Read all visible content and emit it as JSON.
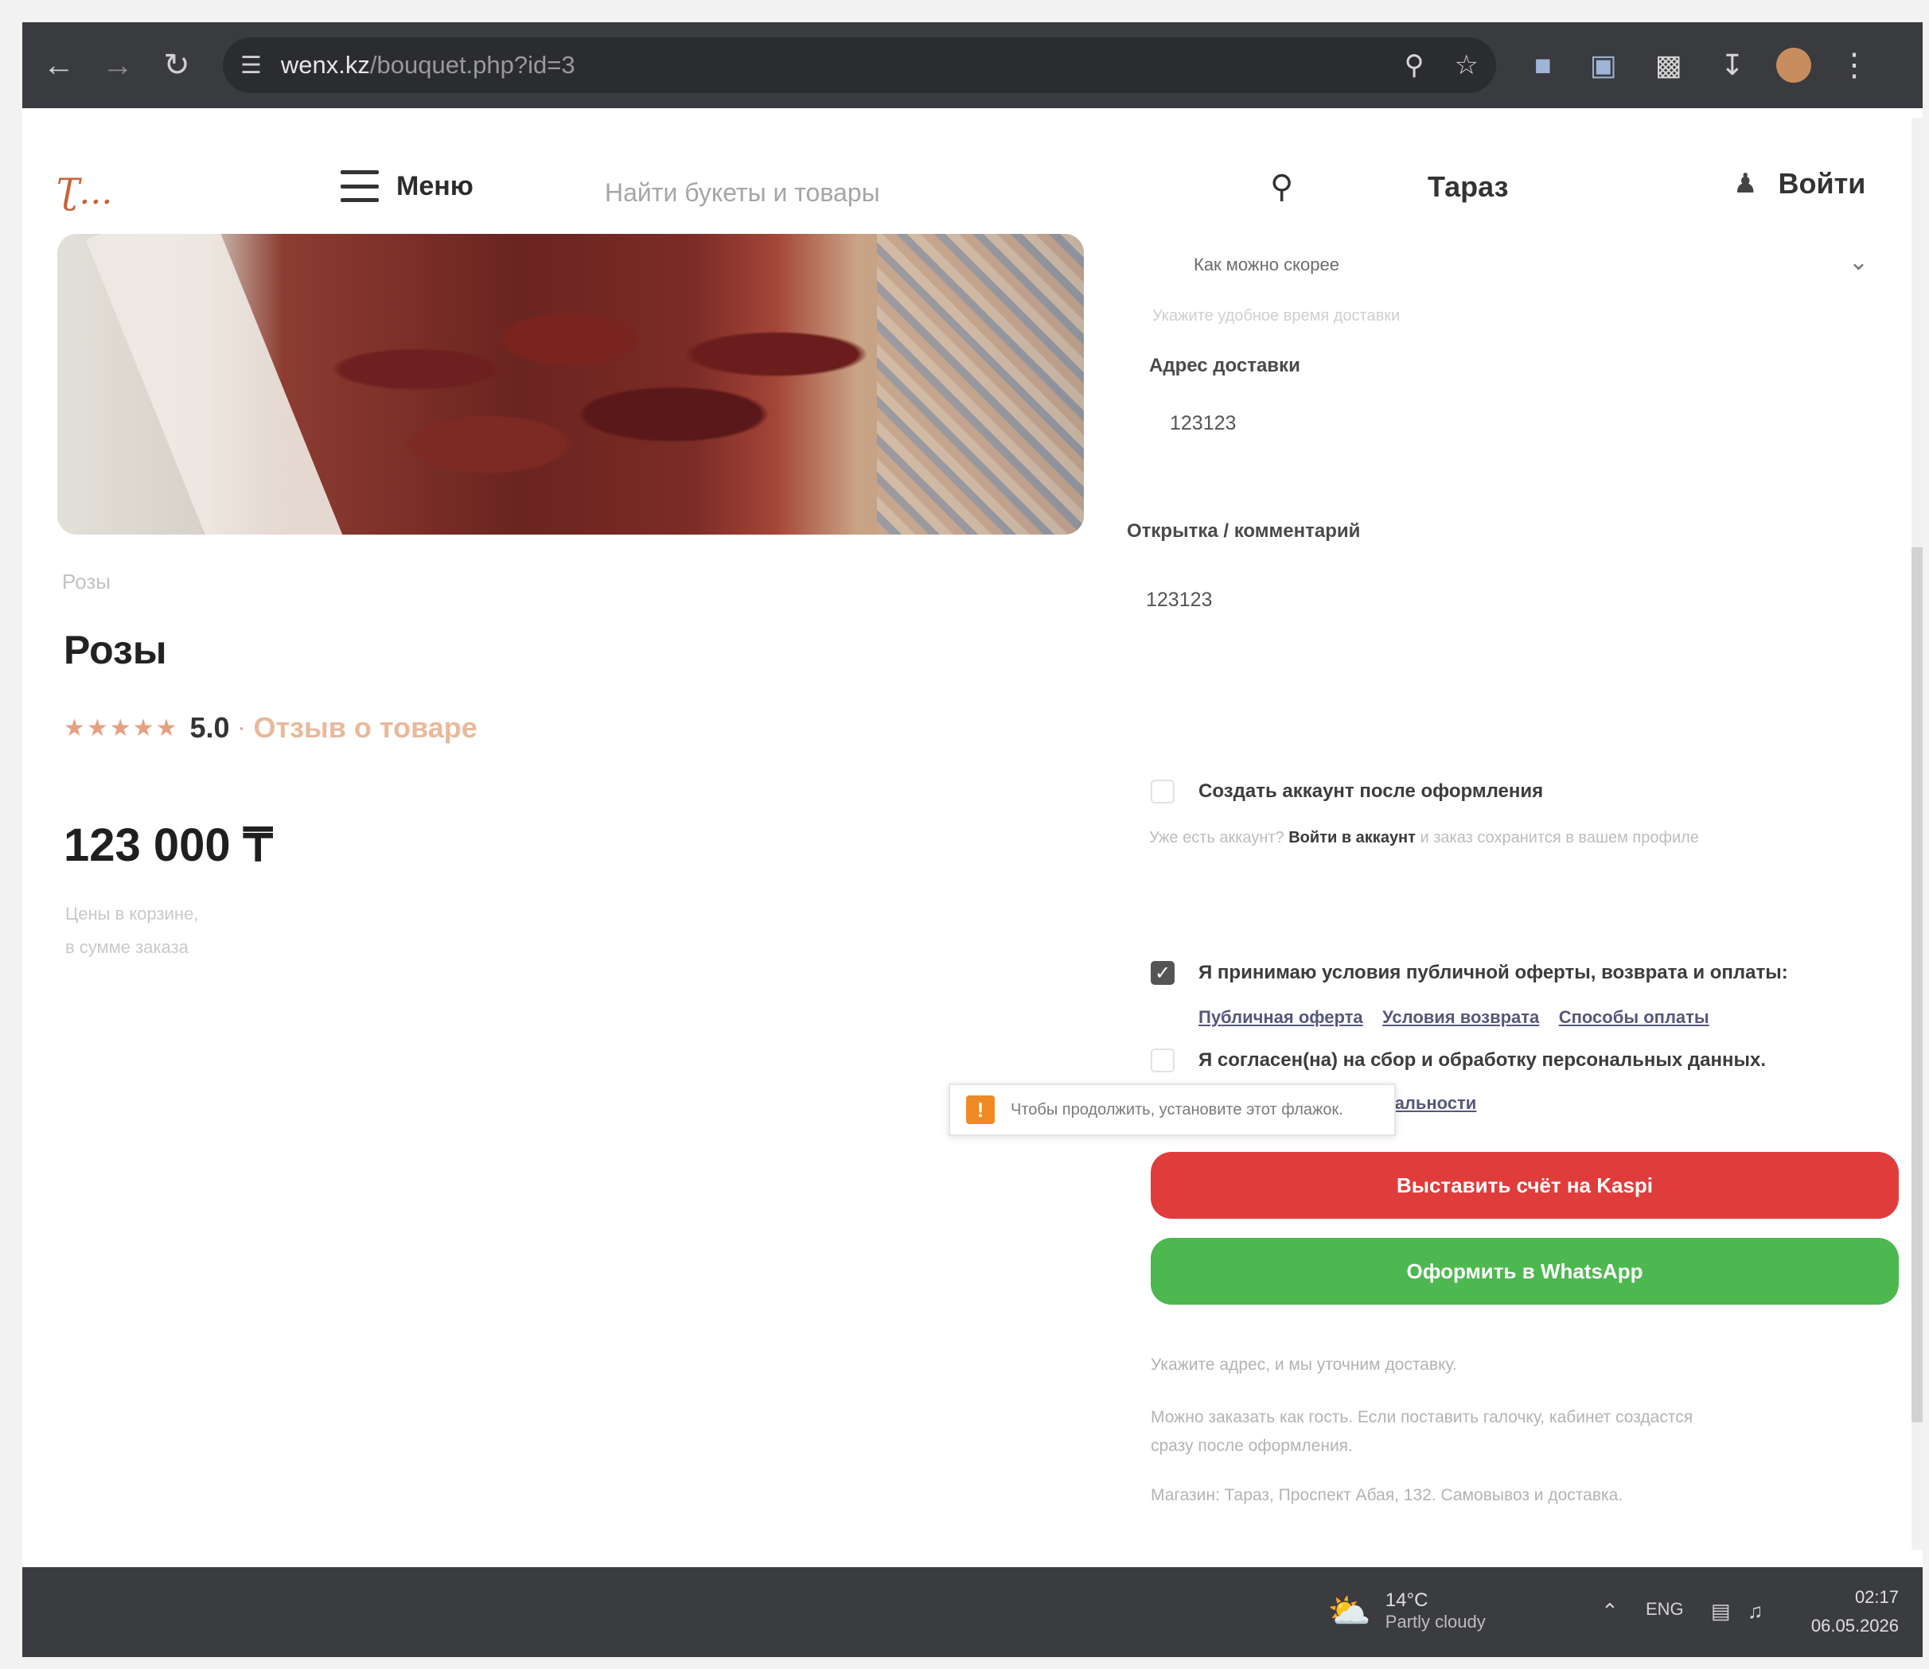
{
  "browser": {
    "url_host": "wenx.kz",
    "url_path": "/bouquet.php?id=3"
  },
  "header": {
    "logo_text": "Ʈ...",
    "menu_label": "Меню",
    "search_placeholder": "Найти букеты и товары",
    "city": "Тараз",
    "login_label": "Войти"
  },
  "product": {
    "breadcrumb": "Розы",
    "title": "Розы",
    "stars": "★★★★★",
    "rating": "5.0",
    "separator": "·",
    "reviews_link": "Отзыв о товаре",
    "price": "123 000 ₸",
    "note_1": "Цены в корзине,",
    "note_2": "в сумме заказа"
  },
  "form": {
    "time_select_value": "Как можно скорее",
    "time_hint": "Укажите удобное время доставки",
    "address_label": "Адрес доставки",
    "address_value": "123123",
    "card_label": "Открытка / комментарий",
    "card_value": "123123",
    "create_account_label": "Создать аккаунт после оформления",
    "account_hint_prefix": "Уже есть аккаунт?",
    "account_login_link": "Войти в аккаунт",
    "account_hint_suffix": "и заказ сохранится в вашем профиле",
    "accept_offer_label": "Я принимаю условия публичной оферты, возврата и оплаты:",
    "links": [
      "Публичная оферта",
      "Условия возврата",
      "Способы оплаты"
    ],
    "consent_label": "Я согласен(на) на сбор и обработку персональных данных.",
    "privacy_link": "Политика конфиденциальности",
    "tooltip_icon": "!",
    "tooltip_text": "Чтобы продолжить, установите этот флажок.",
    "kaspi_button": "Выставить счёт на Kaspi",
    "whatsapp_button": "Оформить в WhatsApp",
    "footnote_1": "Укажите адрес, и мы уточним доставку.",
    "footnote_2": "Можно заказать как гость. Если поставить галочку, кабинет создастся",
    "footnote_3": "сразу после оформления.",
    "footnote_4": "Магазин: Тараз, Проспект Абая, 132. Самовывоз и доставка."
  },
  "taskbar": {
    "temp": "14°C",
    "weather": "Partly cloudy",
    "lang": "ENG",
    "time": "02:17",
    "date": "06.05.2026"
  },
  "colors": {
    "kaspi": "#e03c3c",
    "whatsapp": "#4cb84f",
    "accent": "#e8b99b"
  }
}
